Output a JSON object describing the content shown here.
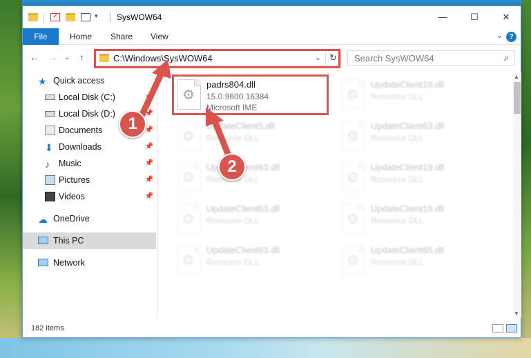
{
  "window": {
    "title": "SysWOW64",
    "minimize": "—",
    "maximize": "☐",
    "close": "✕"
  },
  "ribbon": {
    "tabs": [
      "File",
      "Home",
      "Share",
      "View"
    ],
    "expand": "⌄",
    "help": "?"
  },
  "nav": {
    "back": "←",
    "forward": "→",
    "recent": "⌄",
    "up": "↑",
    "address": "C:\\Windows\\SysWOW64",
    "address_chevron": "⌄",
    "refresh": "↻",
    "search_placeholder": "Search SysWOW64",
    "search_icon": "⌕"
  },
  "sidebar": {
    "items": [
      {
        "label": "Quick access",
        "icon": "star-icon",
        "pinned": false
      },
      {
        "label": "Local Disk (C:)",
        "icon": "drive-icon",
        "pinned": true
      },
      {
        "label": "Local Disk (D:)",
        "icon": "drive-icon",
        "pinned": true
      },
      {
        "label": "Documents",
        "icon": "documents-icon",
        "pinned": true
      },
      {
        "label": "Downloads",
        "icon": "download-icon",
        "pinned": true
      },
      {
        "label": "Music",
        "icon": "music-icon",
        "pinned": true
      },
      {
        "label": "Pictures",
        "icon": "pictures-icon",
        "pinned": true
      },
      {
        "label": "Videos",
        "icon": "videos-icon",
        "pinned": true
      },
      {
        "label": "OneDrive",
        "icon": "cloud-icon",
        "pinned": false
      },
      {
        "label": "This PC",
        "icon": "computer-icon",
        "pinned": false,
        "selected": true
      },
      {
        "label": "Network",
        "icon": "network-icon",
        "pinned": false
      }
    ],
    "pin_glyph": "📌"
  },
  "files": [
    {
      "name": "padrs804.dll",
      "line2": "15.0.9600.16384",
      "line3": "Microsoft IME",
      "highlighted": true
    },
    {
      "name": "UpdateClient19.dll",
      "line2": "Resource DLL",
      "faded": true
    },
    {
      "name": "UpdateClient5.dll",
      "line2": "Resource DLL",
      "faded": true
    },
    {
      "name": "UpdateClient63.dll",
      "line2": "Resource DLL",
      "faded": true
    },
    {
      "name": "UpdateClient63.dll",
      "line2": "Resource DLL",
      "faded": true
    },
    {
      "name": "UpdateClient19.dll",
      "line2": "Resource DLL",
      "faded": true
    },
    {
      "name": "UpdateClient63.dll",
      "line2": "Resource DLL",
      "faded": true
    },
    {
      "name": "UpdateClient19.dll",
      "line2": "Resource DLL",
      "faded": true
    },
    {
      "name": "UpdateClient63.dll",
      "line2": "Resource DLL",
      "faded": true
    },
    {
      "name": "UpdateClient65.dll",
      "line2": "Resource DLL",
      "faded": true
    }
  ],
  "status": {
    "item_count": "182 items"
  },
  "annotations": {
    "step1": "1",
    "step2": "2",
    "color": "#d9534f"
  }
}
